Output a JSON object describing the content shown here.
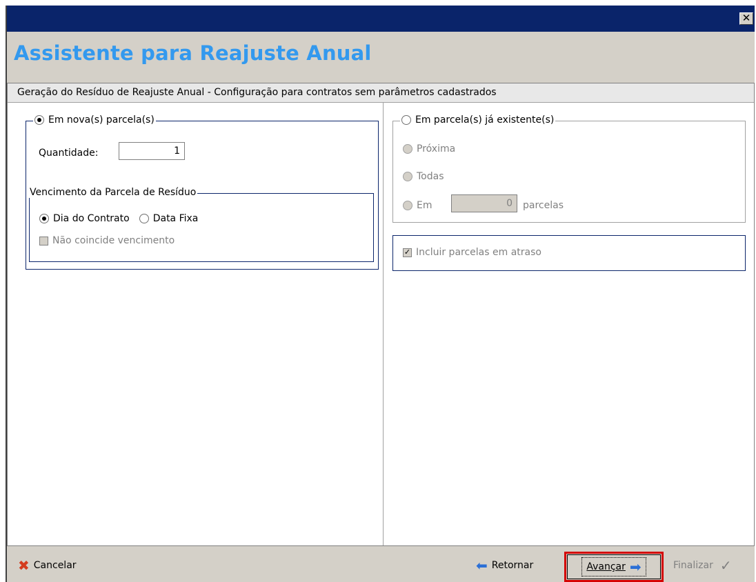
{
  "window": {
    "close_symbol": "✕"
  },
  "header": {
    "title": "Assistente para Reajuste Anual"
  },
  "panel": {
    "title": "Geração do Resíduo de Reajuste Anual - Configuração para contratos sem parâmetros cadastrados"
  },
  "left": {
    "group_label": "Em nova(s) parcela(s)",
    "quantity_label": "Quantidade:",
    "quantity_value": "1",
    "due_group_label": "Vencimento da Parcela de Resíduo",
    "option_contract_day": "Dia do Contrato",
    "option_fixed_date": "Data Fixa",
    "not_coincide_label": "Não coincide vencimento"
  },
  "right": {
    "group_label": "Em parcela(s) já existente(s)",
    "option_next": "Próxima",
    "option_all": "Todas",
    "option_in": "Em",
    "in_value": "0",
    "in_suffix": "parcelas",
    "include_overdue": "Incluir parcelas em atraso"
  },
  "footer": {
    "cancel": "Cancelar",
    "back": "Retornar",
    "next": "Avançar",
    "finish": "Finalizar"
  },
  "colors": {
    "title_blue": "#3399ee",
    "titlebar": "#0a246a",
    "highlight": "#d40000"
  },
  "icons": [
    "close-icon",
    "cancel-x-icon",
    "back-arrow-icon",
    "next-arrow-icon",
    "check-icon"
  ]
}
